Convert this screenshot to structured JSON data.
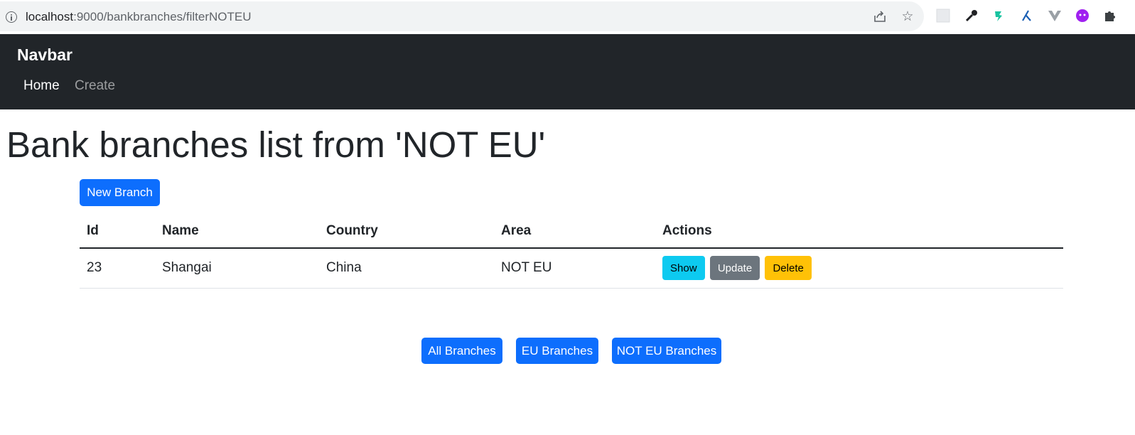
{
  "browser": {
    "url_host": "localhost",
    "url_path": ":9000/bankbranches/filterNOTEU",
    "icons": [
      "info-icon",
      "share-icon",
      "star-icon",
      "extension-grid-icon",
      "eyedropper-icon",
      "dragon-icon",
      "branch-icon",
      "vue-icon",
      "purple-face-icon",
      "puzzle-icon"
    ]
  },
  "navbar": {
    "brand": "Navbar",
    "links": [
      {
        "label": "Home",
        "active": true
      },
      {
        "label": "Create",
        "active": false
      }
    ]
  },
  "page": {
    "title": "Bank branches list from 'NOT EU'",
    "new_branch_label": "New Branch"
  },
  "table": {
    "headers": [
      "Id",
      "Name",
      "Country",
      "Area",
      "Actions"
    ],
    "rows": [
      {
        "id": "23",
        "name": "Shangai",
        "country": "China",
        "area": "NOT EU",
        "actions": {
          "show": "Show",
          "update": "Update",
          "delete": "Delete"
        }
      }
    ]
  },
  "filters": {
    "all": "All Branches",
    "eu": "EU Branches",
    "not_eu": "NOT EU Branches"
  },
  "colors": {
    "navbar_bg": "#212529",
    "primary": "#0d6efd",
    "info": "#0dcaf0",
    "secondary": "#6c757d",
    "warning": "#ffc107"
  }
}
